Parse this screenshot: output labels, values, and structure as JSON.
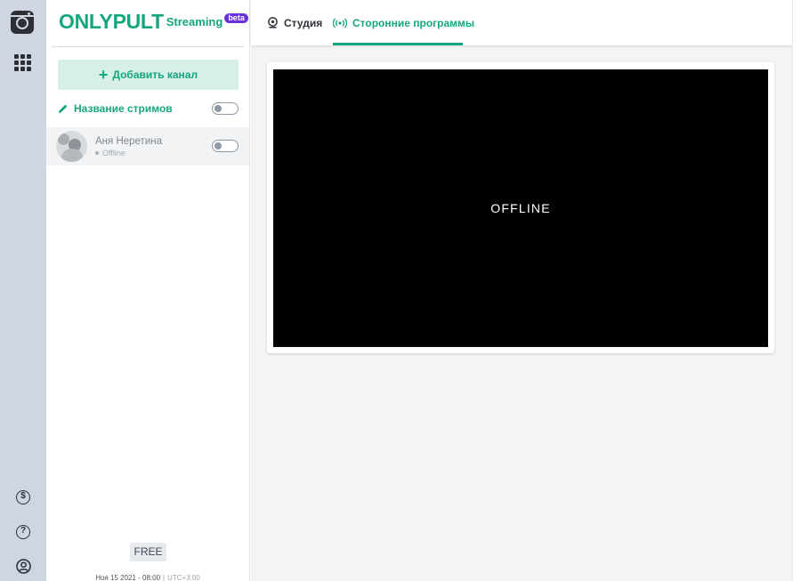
{
  "brand": {
    "name": "ONLYPULT",
    "product": "Streaming",
    "badge": "beta",
    "color": "#15a57f",
    "badge_color": "#6a33d9"
  },
  "rail": {
    "icons": [
      "app-logo-icon",
      "apps-grid-icon",
      "dollar-icon",
      "help-icon",
      "account-icon"
    ],
    "dollar_glyph": "$",
    "help_glyph": "?"
  },
  "sidebar": {
    "add_channel_label": "Добавить канал",
    "stream_name_label": "Название стримов",
    "channels": [
      {
        "name": "Аня Неретина",
        "status": "Offline"
      }
    ],
    "plan": "FREE",
    "footer_time": "Ноя 15 2021 - 08:00",
    "footer_sep": "|",
    "footer_timezone": "UTC+3:00"
  },
  "tabs": [
    {
      "label": "Студия",
      "icon": "webcam-icon",
      "active": false
    },
    {
      "label": "Сторонние программы",
      "icon": "broadcast-icon",
      "active": true
    }
  ],
  "preview": {
    "status_text": "OFFLINE"
  }
}
